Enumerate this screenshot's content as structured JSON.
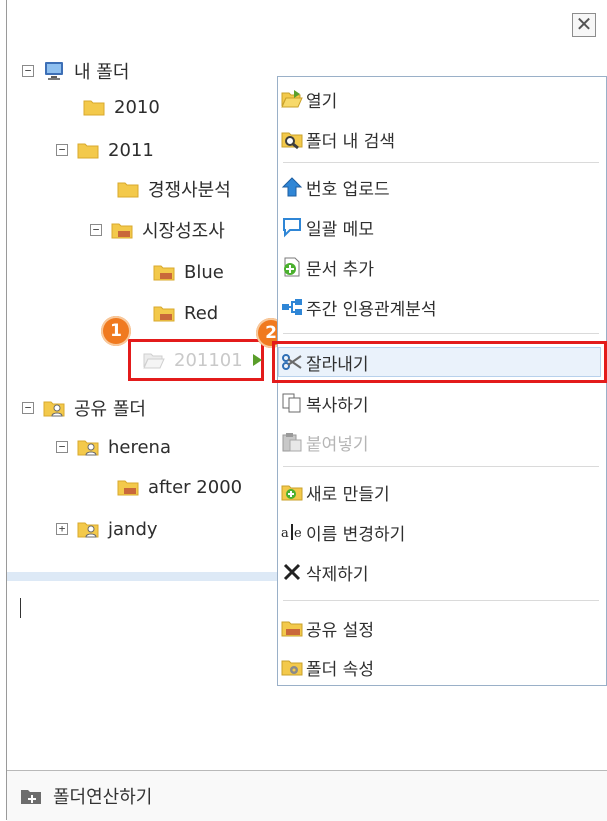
{
  "window": {
    "close_label": "✕"
  },
  "tree": {
    "my_folder": "내 폴더",
    "y2010": "2010",
    "y2011": "2011",
    "competitor": "경쟁사분석",
    "market": "시장성조사",
    "blue": "Blue",
    "red": "Red",
    "sel_folder": "201101",
    "shared": "공유 폴더",
    "herena": "herena",
    "after2000": "after 2000",
    "jandy": "jandy"
  },
  "markers": {
    "one": "1",
    "two": "2"
  },
  "context_menu": {
    "open": "열기",
    "search": "폴더 내 검색",
    "upload": "번호 업로드",
    "memo": "일괄 메모",
    "add_doc": "문서 추가",
    "weekly": "주간 인용관계분석",
    "cut": "잘라내기",
    "copy": "복사하기",
    "paste": "붙여넣기",
    "new_folder": "새로 만들기",
    "rename": "이름 변경하기",
    "delete": "삭제하기",
    "share": "공유 설정",
    "props": "폴더 속성"
  },
  "footer": {
    "label": "폴더연산하기"
  },
  "colors": {
    "accent_red": "#e31b1b",
    "marker_orange": "#f07a20",
    "folder_yellow": "#f3c94b",
    "menu_border": "#9ab0c8"
  }
}
